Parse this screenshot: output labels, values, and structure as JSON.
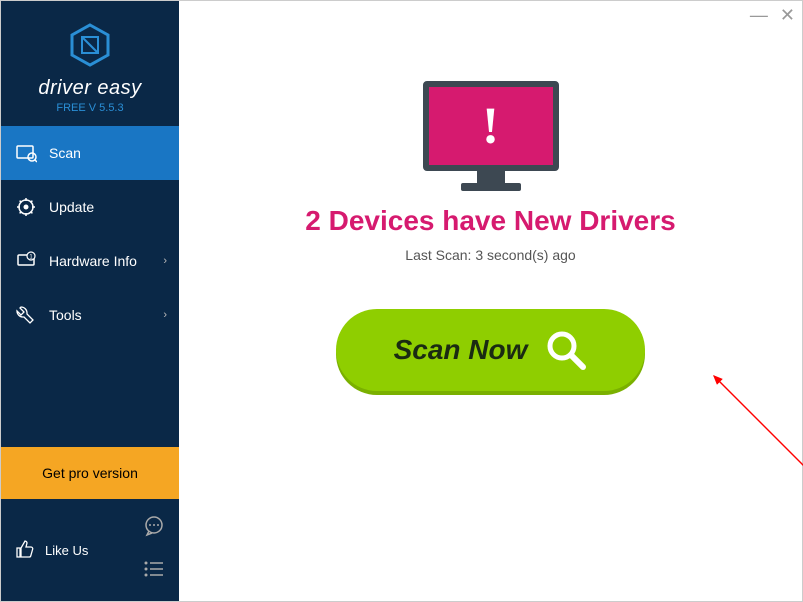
{
  "brand": "driver easy",
  "version": "FREE V 5.5.3",
  "sidebar": {
    "items": [
      {
        "label": "Scan"
      },
      {
        "label": "Update"
      },
      {
        "label": "Hardware Info"
      },
      {
        "label": "Tools"
      }
    ],
    "get_pro": "Get pro version",
    "like_us": "Like Us"
  },
  "main": {
    "headline": "2 Devices have New Drivers",
    "last_scan": "Last Scan: 3 second(s) ago",
    "scan_button": "Scan Now"
  },
  "window": {
    "minimize": "—",
    "close": "✕"
  }
}
